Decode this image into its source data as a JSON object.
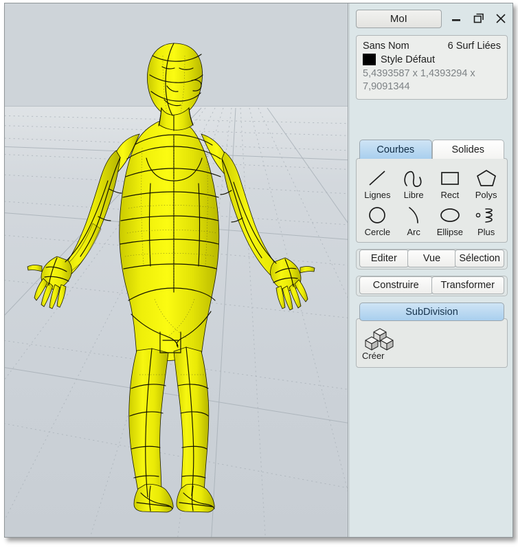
{
  "window": {
    "title": "MoI",
    "minimize_label": "–",
    "restore_label": "❐",
    "close_label": "✕"
  },
  "object_info": {
    "name": "Sans Nom",
    "count": "6 Surf Liées",
    "style": "Style Défaut",
    "style_color": "#000000",
    "dimensions": "5,4393587 x 1,4393294 x 7,9091344"
  },
  "palette": {
    "tabs": [
      {
        "label": "Courbes",
        "active": true
      },
      {
        "label": "Solides",
        "active": false
      }
    ],
    "tools": [
      {
        "label": "Lignes",
        "icon": "line-icon"
      },
      {
        "label": "Libre",
        "icon": "freeform-curve-icon"
      },
      {
        "label": "Rect",
        "icon": "rectangle-icon"
      },
      {
        "label": "Polys",
        "icon": "polygon-icon"
      },
      {
        "label": "Cercle",
        "icon": "circle-icon"
      },
      {
        "label": "Arc",
        "icon": "arc-icon"
      },
      {
        "label": "Ellipse",
        "icon": "ellipse-icon"
      },
      {
        "label": "Plus",
        "icon": "helix-more-icon"
      }
    ]
  },
  "menus": {
    "row1": [
      "Editer",
      "Vue",
      "Sélection"
    ],
    "row2": [
      "Construire",
      "Transformer"
    ]
  },
  "subdivision": {
    "header": "SubDivision",
    "tools": [
      {
        "label": "Créer",
        "icon": "cubes-icon"
      }
    ]
  },
  "viewport": {
    "model_color": "#e8e800",
    "model_edge_color": "#141414",
    "sky_color": "#ced4d9",
    "ground_color": "#d3d8dd"
  }
}
